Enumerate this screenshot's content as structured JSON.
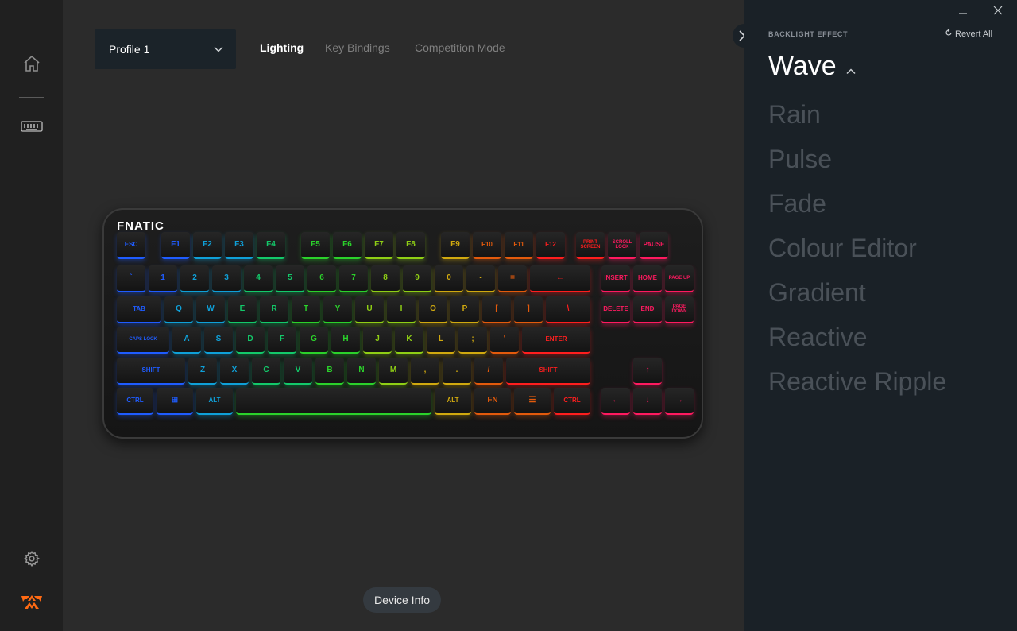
{
  "header": {
    "profile": {
      "value": "Profile 1"
    },
    "tabs": [
      {
        "label": "Lighting",
        "active": true
      },
      {
        "label": "Key Bindings",
        "active": false
      },
      {
        "label": "Competition Mode",
        "active": false
      }
    ]
  },
  "keyboard": {
    "brand": "FNATIC",
    "rows": [
      [
        "ESC",
        "F1",
        "F2",
        "F3",
        "F4",
        "F5",
        "F6",
        "F7",
        "F8",
        "F9",
        "F10",
        "F11",
        "F12",
        "PRINT SCREEN",
        "SCROLL LOCK",
        "PAUSE"
      ],
      [
        "`",
        "1",
        "2",
        "3",
        "4",
        "5",
        "6",
        "7",
        "8",
        "9",
        "0",
        "-",
        "=",
        "←",
        "INSERT",
        "HOME",
        "PAGE UP"
      ],
      [
        "TAB",
        "Q",
        "W",
        "E",
        "R",
        "T",
        "Y",
        "U",
        "I",
        "O",
        "P",
        "[",
        "]",
        "\\",
        "DELETE",
        "END",
        "PAGE DOWN"
      ],
      [
        "CAPS LOCK",
        "A",
        "S",
        "D",
        "F",
        "G",
        "H",
        "J",
        "K",
        "L",
        ";",
        "'",
        "ENTER"
      ],
      [
        "SHIFT",
        "Z",
        "X",
        "C",
        "V",
        "B",
        "N",
        "M",
        ",",
        ".",
        "/",
        "SHIFT",
        "↑"
      ],
      [
        "CTRL",
        "⊞",
        "ALT",
        "",
        "ALT",
        "FN",
        "☰",
        "CTRL",
        "←",
        "↓",
        "→"
      ]
    ],
    "wave_colors": [
      "#1f5cff",
      "#0fa0d8",
      "#13c96a",
      "#2bd12b",
      "#8fcf15",
      "#d0a90f",
      "#e35a0c",
      "#ff1e1e",
      "#ff1a60"
    ]
  },
  "footer": {
    "device_info": "Device Info"
  },
  "panel": {
    "section_label": "BACKLIGHT EFFECT",
    "revert_label": "Revert All",
    "current_effect": "Wave",
    "effects": [
      "Rain",
      "Pulse",
      "Fade",
      "Colour Editor",
      "Gradient",
      "Reactive",
      "Reactive Ripple"
    ]
  },
  "colors": {
    "accent": "#ff6a13",
    "panel_bg": "#1a2127",
    "text_dim": "#4a5158"
  },
  "icons": [
    "home-icon",
    "keyboard-icon",
    "settings-icon",
    "fnatic-logo-icon",
    "chevron-down-icon",
    "close-icon",
    "revert-icon",
    "chevron-up-icon",
    "minimize-icon"
  ]
}
